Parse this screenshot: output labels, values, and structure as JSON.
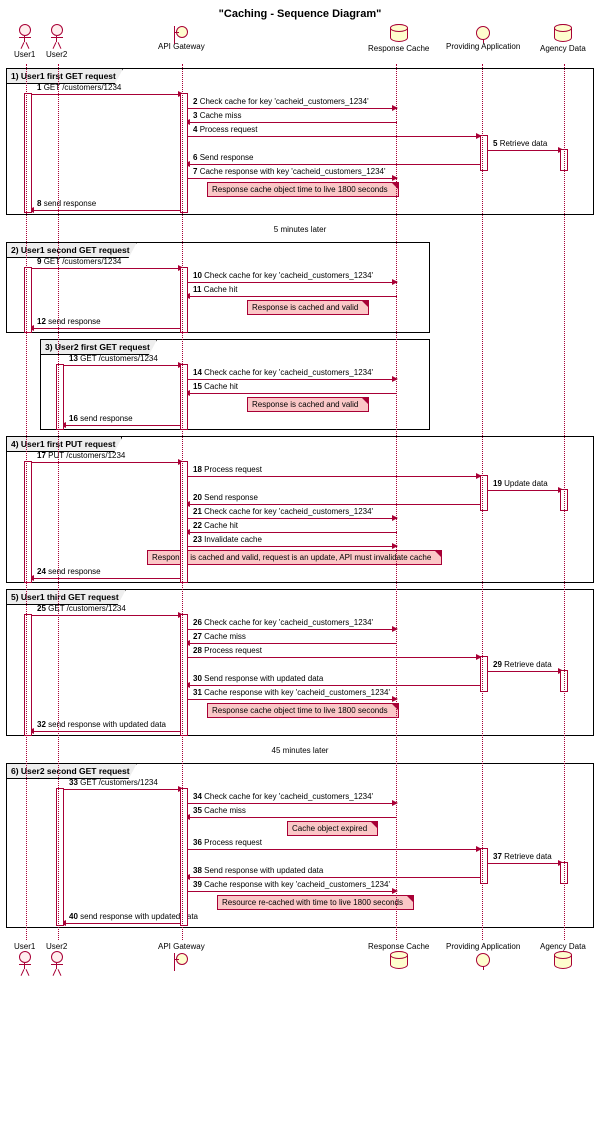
{
  "title": "\"Caching - Sequence Diagram\"",
  "participants": {
    "user1": "User1",
    "user2": "User2",
    "gateway": "API Gateway",
    "cache": "Response Cache",
    "app": "Providing Application",
    "data": "Agency Data"
  },
  "lanes": {
    "user1": 26,
    "user2": 58,
    "gateway": 182,
    "cache": 396,
    "app": 482,
    "data": 564
  },
  "delays": {
    "d1": "5 minutes later",
    "d2": "45 minutes later"
  },
  "groups": {
    "g1": "1) User1 first GET request",
    "g2": "2) User1 second GET request",
    "g3": "3) User2 first GET request",
    "g4": "4) User1 first PUT request",
    "g5": "5) User1 third GET request",
    "g6": "6) User2 second GET request"
  },
  "notes": {
    "n1": "Response cache object time to live 1800 seconds",
    "n2": "Response is cached and valid",
    "n3": "Response is cached and valid",
    "n4": "Response is cached and valid, request is an update, API must invalidate cache",
    "n5": "Response cache object time to live 1800 seconds",
    "n6": "Cache object expired",
    "n7": "Resource re-cached with time to live 1800 seconds"
  },
  "messages": {
    "m1": {
      "n": "1",
      "t": "GET /customers/1234"
    },
    "m2": {
      "n": "2",
      "t": "Check cache for key 'cacheid_customers_1234'"
    },
    "m3": {
      "n": "3",
      "t": "Cache miss"
    },
    "m4": {
      "n": "4",
      "t": "Process request"
    },
    "m5": {
      "n": "5",
      "t": "Retrieve data"
    },
    "m6": {
      "n": "6",
      "t": "Send response"
    },
    "m7": {
      "n": "7",
      "t": "Cache response with key 'cacheid_customers_1234'"
    },
    "m8": {
      "n": "8",
      "t": "send response"
    },
    "m9": {
      "n": "9",
      "t": "GET /customers/1234"
    },
    "m10": {
      "n": "10",
      "t": "Check cache for key 'cacheid_customers_1234'"
    },
    "m11": {
      "n": "11",
      "t": "Cache hit"
    },
    "m12": {
      "n": "12",
      "t": "send response"
    },
    "m13": {
      "n": "13",
      "t": "GET /customers/1234"
    },
    "m14": {
      "n": "14",
      "t": "Check cache for key 'cacheid_customers_1234'"
    },
    "m15": {
      "n": "15",
      "t": "Cache hit"
    },
    "m16": {
      "n": "16",
      "t": "send response"
    },
    "m17": {
      "n": "17",
      "t": "PUT /customers/1234"
    },
    "m18": {
      "n": "18",
      "t": "Process request"
    },
    "m19": {
      "n": "19",
      "t": "Update data"
    },
    "m20": {
      "n": "20",
      "t": "Send response"
    },
    "m21": {
      "n": "21",
      "t": "Check cache for key 'cacheid_customers_1234'"
    },
    "m22": {
      "n": "22",
      "t": "Cache hit"
    },
    "m23": {
      "n": "23",
      "t": "Invalidate cache"
    },
    "m24": {
      "n": "24",
      "t": "send response"
    },
    "m25": {
      "n": "25",
      "t": "GET /customers/1234"
    },
    "m26": {
      "n": "26",
      "t": "Check cache for key 'cacheid_customers_1234'"
    },
    "m27": {
      "n": "27",
      "t": "Cache miss"
    },
    "m28": {
      "n": "28",
      "t": "Process request"
    },
    "m29": {
      "n": "29",
      "t": "Retrieve data"
    },
    "m30": {
      "n": "30",
      "t": "Send response with updated data"
    },
    "m31": {
      "n": "31",
      "t": "Cache response with key 'cacheid_customers_1234'"
    },
    "m32": {
      "n": "32",
      "t": "send response with updated data"
    },
    "m33": {
      "n": "33",
      "t": "GET /customers/1234"
    },
    "m34": {
      "n": "34",
      "t": "Check cache for key 'cacheid_customers_1234'"
    },
    "m35": {
      "n": "35",
      "t": "Cache miss"
    },
    "m36": {
      "n": "36",
      "t": "Process request"
    },
    "m37": {
      "n": "37",
      "t": "Retrieve data"
    },
    "m38": {
      "n": "38",
      "t": "Send response with updated data"
    },
    "m39": {
      "n": "39",
      "t": "Cache response with key 'cacheid_customers_1234'"
    },
    "m40": {
      "n": "40",
      "t": "send response with updated data"
    }
  },
  "chart_data": {
    "type": "sequence-diagram",
    "title": "Caching - Sequence Diagram",
    "participants": [
      "User1",
      "User2",
      "API Gateway",
      "Response Cache",
      "Providing Application",
      "Agency Data"
    ],
    "groups": [
      {
        "label": "1) User1 first GET request",
        "messages": [
          {
            "n": 1,
            "from": "User1",
            "to": "API Gateway",
            "text": "GET /customers/1234"
          },
          {
            "n": 2,
            "from": "API Gateway",
            "to": "Response Cache",
            "text": "Check cache for key 'cacheid_customers_1234'"
          },
          {
            "n": 3,
            "from": "Response Cache",
            "to": "API Gateway",
            "text": "Cache miss"
          },
          {
            "n": 4,
            "from": "API Gateway",
            "to": "Providing Application",
            "text": "Process request"
          },
          {
            "n": 5,
            "from": "Providing Application",
            "to": "Agency Data",
            "text": "Retrieve data"
          },
          {
            "n": 6,
            "from": "Providing Application",
            "to": "API Gateway",
            "text": "Send response"
          },
          {
            "n": 7,
            "from": "API Gateway",
            "to": "Response Cache",
            "text": "Cache response with key 'cacheid_customers_1234'"
          },
          {
            "note": "Response cache object time to live 1800 seconds"
          },
          {
            "n": 8,
            "from": "API Gateway",
            "to": "User1",
            "text": "send response"
          }
        ]
      },
      {
        "delay": "5 minutes later"
      },
      {
        "label": "2) User1 second GET request",
        "messages": [
          {
            "n": 9,
            "from": "User1",
            "to": "API Gateway",
            "text": "GET /customers/1234"
          },
          {
            "n": 10,
            "from": "API Gateway",
            "to": "Response Cache",
            "text": "Check cache for key 'cacheid_customers_1234'"
          },
          {
            "n": 11,
            "from": "Response Cache",
            "to": "API Gateway",
            "text": "Cache hit"
          },
          {
            "note": "Response is cached and valid"
          },
          {
            "n": 12,
            "from": "API Gateway",
            "to": "User1",
            "text": "send response"
          }
        ]
      },
      {
        "label": "3) User2 first GET request",
        "messages": [
          {
            "n": 13,
            "from": "User2",
            "to": "API Gateway",
            "text": "GET /customers/1234"
          },
          {
            "n": 14,
            "from": "API Gateway",
            "to": "Response Cache",
            "text": "Check cache for key 'cacheid_customers_1234'"
          },
          {
            "n": 15,
            "from": "Response Cache",
            "to": "API Gateway",
            "text": "Cache hit"
          },
          {
            "note": "Response is cached and valid"
          },
          {
            "n": 16,
            "from": "API Gateway",
            "to": "User2",
            "text": "send response"
          }
        ]
      },
      {
        "label": "4) User1 first PUT request",
        "messages": [
          {
            "n": 17,
            "from": "User1",
            "to": "API Gateway",
            "text": "PUT /customers/1234"
          },
          {
            "n": 18,
            "from": "API Gateway",
            "to": "Providing Application",
            "text": "Process request"
          },
          {
            "n": 19,
            "from": "Providing Application",
            "to": "Agency Data",
            "text": "Update data"
          },
          {
            "n": 20,
            "from": "Providing Application",
            "to": "API Gateway",
            "text": "Send response"
          },
          {
            "n": 21,
            "from": "API Gateway",
            "to": "Response Cache",
            "text": "Check cache for key 'cacheid_customers_1234'"
          },
          {
            "n": 22,
            "from": "Response Cache",
            "to": "API Gateway",
            "text": "Cache hit"
          },
          {
            "n": 23,
            "from": "API Gateway",
            "to": "Response Cache",
            "text": "Invalidate cache"
          },
          {
            "note": "Response is cached and valid, request is an update, API must invalidate cache"
          },
          {
            "n": 24,
            "from": "API Gateway",
            "to": "User1",
            "text": "send response"
          }
        ]
      },
      {
        "label": "5) User1 third GET request",
        "messages": [
          {
            "n": 25,
            "from": "User1",
            "to": "API Gateway",
            "text": "GET /customers/1234"
          },
          {
            "n": 26,
            "from": "API Gateway",
            "to": "Response Cache",
            "text": "Check cache for key 'cacheid_customers_1234'"
          },
          {
            "n": 27,
            "from": "Response Cache",
            "to": "API Gateway",
            "text": "Cache miss"
          },
          {
            "n": 28,
            "from": "API Gateway",
            "to": "Providing Application",
            "text": "Process request"
          },
          {
            "n": 29,
            "from": "Providing Application",
            "to": "Agency Data",
            "text": "Retrieve data"
          },
          {
            "n": 30,
            "from": "Providing Application",
            "to": "API Gateway",
            "text": "Send response with updated data"
          },
          {
            "n": 31,
            "from": "API Gateway",
            "to": "Response Cache",
            "text": "Cache response with key 'cacheid_customers_1234'"
          },
          {
            "note": "Response cache object time to live 1800 seconds"
          },
          {
            "n": 32,
            "from": "API Gateway",
            "to": "User1",
            "text": "send response with updated data"
          }
        ]
      },
      {
        "delay": "45 minutes later"
      },
      {
        "label": "6) User2 second GET request",
        "messages": [
          {
            "n": 33,
            "from": "User2",
            "to": "API Gateway",
            "text": "GET /customers/1234"
          },
          {
            "n": 34,
            "from": "API Gateway",
            "to": "Response Cache",
            "text": "Check cache for key 'cacheid_customers_1234'"
          },
          {
            "n": 35,
            "from": "Response Cache",
            "to": "API Gateway",
            "text": "Cache miss"
          },
          {
            "note": "Cache object expired"
          },
          {
            "n": 36,
            "from": "API Gateway",
            "to": "Providing Application",
            "text": "Process request"
          },
          {
            "n": 37,
            "from": "Providing Application",
            "to": "Agency Data",
            "text": "Retrieve data"
          },
          {
            "n": 38,
            "from": "Providing Application",
            "to": "API Gateway",
            "text": "Send response with updated data"
          },
          {
            "n": 39,
            "from": "API Gateway",
            "to": "Response Cache",
            "text": "Cache response with key 'cacheid_customers_1234'"
          },
          {
            "note": "Resource re-cached with time to live 1800 seconds"
          },
          {
            "n": 40,
            "from": "API Gateway",
            "to": "User2",
            "text": "send response with updated data"
          }
        ]
      }
    ]
  }
}
